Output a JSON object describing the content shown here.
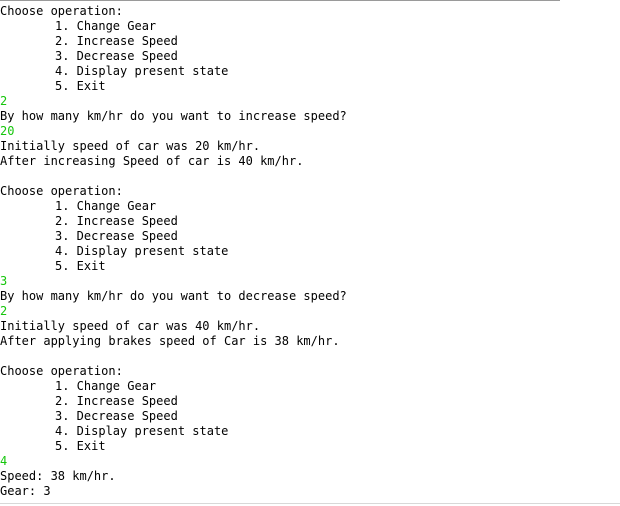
{
  "console": {
    "colors": {
      "text": "#000000",
      "user_input": "#16c60c",
      "background": "#ffffff"
    },
    "lines": [
      {
        "kind": "text",
        "text": "Choose operation:"
      },
      {
        "kind": "opt",
        "text": "1. Change Gear"
      },
      {
        "kind": "opt",
        "text": "2. Increase Speed"
      },
      {
        "kind": "opt",
        "text": "3. Decrease Speed"
      },
      {
        "kind": "opt",
        "text": "4. Display present state"
      },
      {
        "kind": "opt",
        "text": "5. Exit"
      },
      {
        "kind": "input",
        "text": "2"
      },
      {
        "kind": "text",
        "text": "By how many km/hr do you want to increase speed?"
      },
      {
        "kind": "input",
        "text": "20"
      },
      {
        "kind": "text",
        "text": "Initially speed of car was 20 km/hr."
      },
      {
        "kind": "text",
        "text": "After increasing Speed of car is 40 km/hr."
      },
      {
        "kind": "text",
        "text": ""
      },
      {
        "kind": "text",
        "text": "Choose operation:"
      },
      {
        "kind": "opt",
        "text": "1. Change Gear"
      },
      {
        "kind": "opt",
        "text": "2. Increase Speed"
      },
      {
        "kind": "opt",
        "text": "3. Decrease Speed"
      },
      {
        "kind": "opt",
        "text": "4. Display present state"
      },
      {
        "kind": "opt",
        "text": "5. Exit"
      },
      {
        "kind": "input",
        "text": "3"
      },
      {
        "kind": "text",
        "text": "By how many km/hr do you want to decrease speed?"
      },
      {
        "kind": "input",
        "text": "2"
      },
      {
        "kind": "text",
        "text": "Initially speed of car was 40 km/hr."
      },
      {
        "kind": "text",
        "text": "After applying brakes speed of Car is 38 km/hr."
      },
      {
        "kind": "text",
        "text": ""
      },
      {
        "kind": "text",
        "text": "Choose operation:"
      },
      {
        "kind": "opt",
        "text": "1. Change Gear"
      },
      {
        "kind": "opt",
        "text": "2. Increase Speed"
      },
      {
        "kind": "opt",
        "text": "3. Decrease Speed"
      },
      {
        "kind": "opt",
        "text": "4. Display present state"
      },
      {
        "kind": "opt",
        "text": "5. Exit"
      },
      {
        "kind": "input",
        "text": "4"
      },
      {
        "kind": "text",
        "text": "Speed: 38 km/hr."
      },
      {
        "kind": "text",
        "text": "Gear: 3"
      }
    ]
  }
}
